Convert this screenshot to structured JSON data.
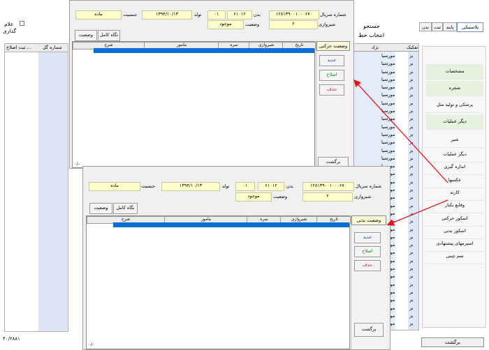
{
  "left_strip": {
    "checkbox_label_1": "علام",
    "checkbox_label_2": "گذاری",
    "col_edit": "ثبت اصلاح ...",
    "col_num": "شماره گل",
    "footer": "۴۰/۲۸۸۱"
  },
  "tabs": [
    "بدن",
    "ثبت",
    "پایند",
    "پلاستیکی"
  ],
  "search": {
    "title": "جستجو",
    "line": "انتخاب خط"
  },
  "list": {
    "header_breed": "نژاد",
    "header_sub": "تفکیک",
    "rows": [
      "بز",
      "بز",
      "بز",
      "بز",
      "بز",
      "بز",
      "بز",
      "بز",
      "بز",
      "بز",
      "بز",
      "بز",
      "بز",
      "بز",
      "بز",
      "بز",
      "بز",
      "بز",
      "بز",
      "بز",
      "بز",
      "بز",
      "بز",
      "بز",
      "بز",
      "بز",
      "بز",
      "بز",
      "بز",
      "بز",
      "بز",
      "بز",
      "بز",
      "بز",
      "بز"
    ],
    "breed_rows": [
      "مورسیا",
      "مورسیا",
      "مورسیا",
      "مورسیا",
      "مورسیا",
      "مورسیا",
      "مورسیا",
      "مورسیا",
      "مورسیا",
      "مورسیا",
      "مورسیا",
      "مورسیا",
      "مورسیا",
      "مورسیا",
      "مورسیا",
      "مورسیا",
      "مورسیا",
      "مورسیا",
      "مورسیا",
      "مورسیا",
      "مورسیا",
      "مورسیا",
      "مورسیا",
      "مورسیا",
      "مورسیا",
      "مورسیا",
      "مورسیا",
      "مورسیا",
      "مورسیا",
      "مورسیا",
      "مورسیا",
      "مورسیا",
      "مورسیا",
      "مورسیا",
      "مورسیا"
    ]
  },
  "menu": {
    "items": [
      "مشخصات",
      "شجره",
      "پزشکی و تولید مثل",
      "دیگر عملیات",
      "شیر",
      "دیگر عملیات",
      "اندازه گیری",
      "عکسها",
      "کارنه",
      "وقایع بکبار",
      "اسکور حرکتی",
      "اسکور بدنی",
      "اسپرمهای پیشنهادی",
      "سم چینی"
    ],
    "back": "برگشت"
  },
  "dialog1": {
    "serial_label": "شماره سریال",
    "serial_value": "۱۲۸۱۳۹۰۰۱۰۰۰۶۷۰",
    "body_label": "بدن",
    "body_value": "۶۱۰۱۲",
    "code_value": "۰۱",
    "birth_label": "تولد",
    "birth_value": "۱۳۹۴/۱۰/۱۳",
    "sex_label": "جنسیت",
    "sex_value": "ماده",
    "shirvari_label": "شیروازی",
    "shirvari_value": "۲",
    "status_label": "وضعیت",
    "status_value": "موجود",
    "btn_status": "وضعیت",
    "btn_full": "نگاه کامل",
    "tab": "وضعیت حرکتی",
    "cols": {
      "date": "تاریخ",
      "shirvari": "شیروازی",
      "score": "نمره",
      "officer": "مامور",
      "desc": "شرح"
    },
    "btn_new": "جدید",
    "btn_edit": "اصلاح",
    "btn_delete": "حذف",
    "btn_back": "برگشت",
    "footer": "۰/-"
  },
  "dialog2": {
    "serial_label": "شماره سریال",
    "serial_value": "۱۲۸۱۳۹۰۰۱۰۰۰۶۷۰",
    "body_label": "بدن",
    "body_value": "۶۱۰۱۲",
    "code_value": "۰۱",
    "birth_label": "تولد",
    "birth_value": "۱۳۹۴/۱۰/۱۳",
    "sex_label": "جنسیت",
    "sex_value": "ماده",
    "shirvari_label": "شیروازی",
    "shirvari_value": "۲",
    "status_label": "وضعیت",
    "status_value": "موجود",
    "btn_status": "وضعیت",
    "btn_full": "نگاه کامل",
    "tab": "وضعیت بدنی",
    "cols": {
      "date": "تاریخ",
      "shirvari": "شیروازی",
      "score": "نمره",
      "officer": "مامور",
      "desc": "شرح"
    },
    "btn_new": "جدید",
    "btn_edit": "اصلاح",
    "btn_delete": "حذف",
    "btn_back": "برگشت",
    "footer": "۰/-"
  },
  "colors": {
    "selection": "#0a6fd2",
    "field": "#ffffcc",
    "arrow": "#e8141c",
    "delete_text": "#d01010",
    "edit_text": "#1a8a1a",
    "new_text": "#1a3fb0"
  }
}
